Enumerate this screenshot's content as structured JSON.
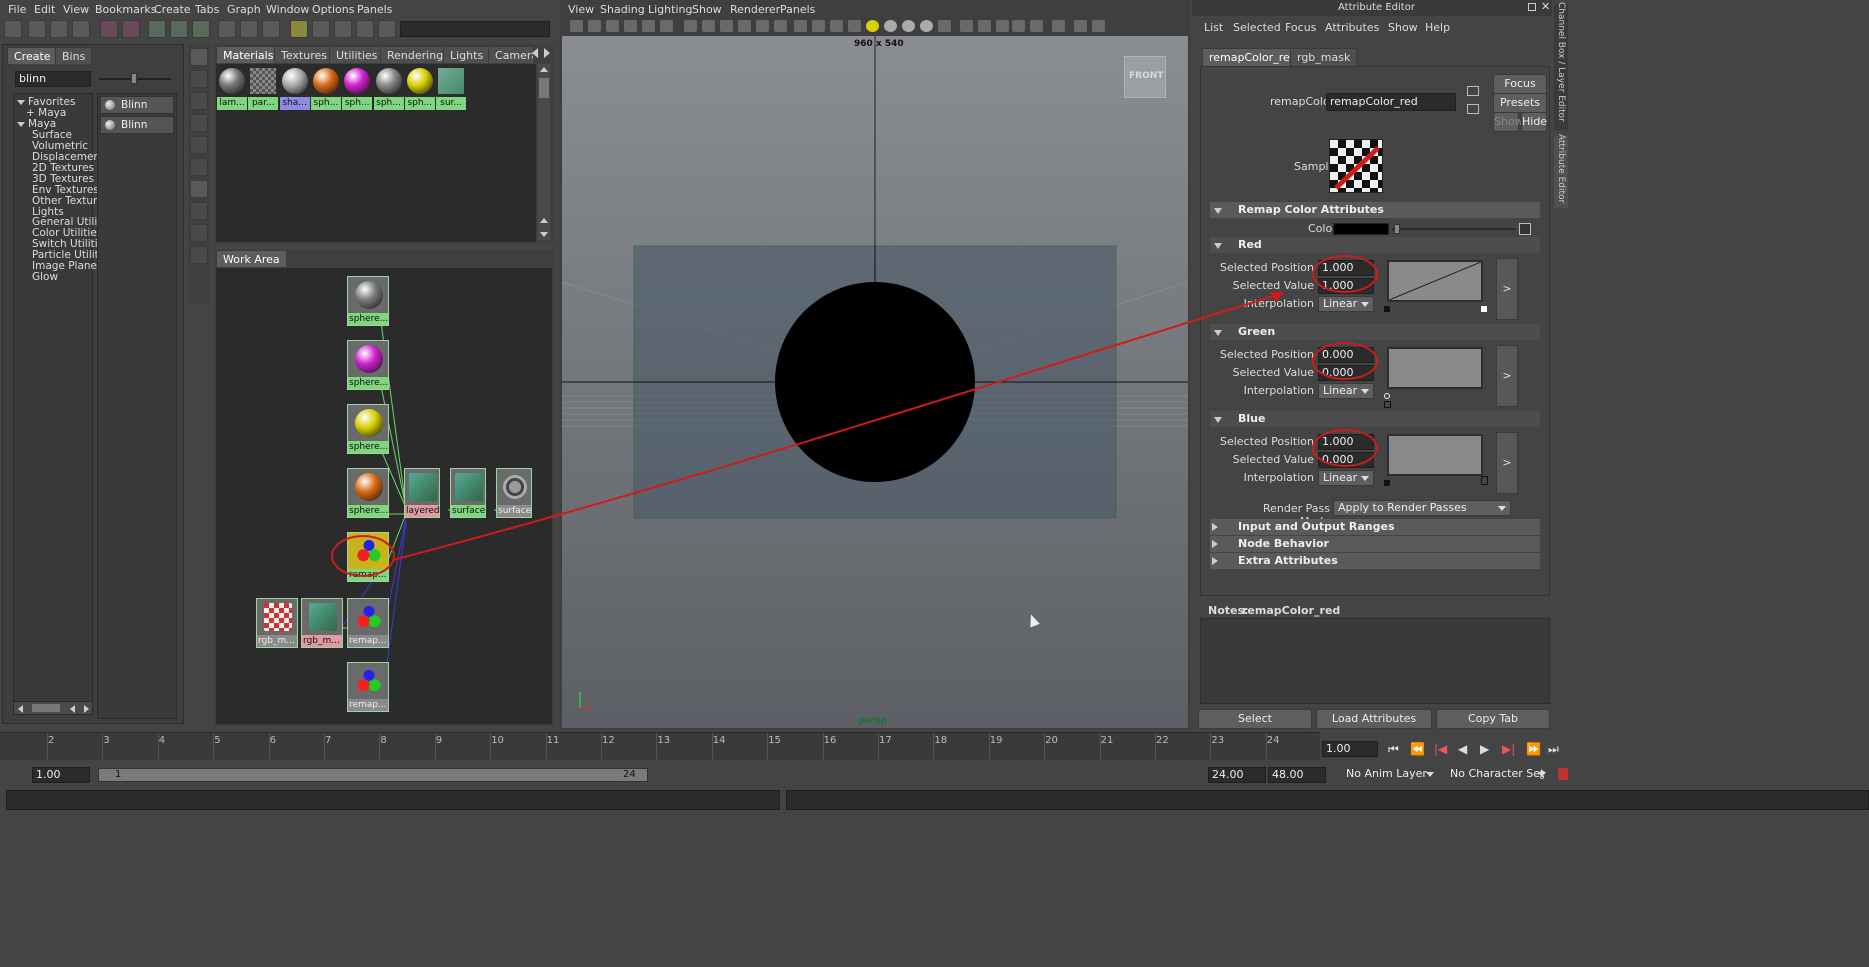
{
  "menubar": {
    "items": [
      "File",
      "Edit",
      "View",
      "Bookmarks",
      "Create",
      "Tabs",
      "Graph",
      "Window",
      "Options",
      "Panels"
    ]
  },
  "hypershade": {
    "left_tabs": [
      "Create",
      "Bins"
    ],
    "search_value": "blinn",
    "tree": [
      {
        "label": "Favorites",
        "expanded": true
      },
      {
        "label": "+ Maya",
        "indent": true
      },
      {
        "label": "Maya",
        "expanded": true
      },
      {
        "label": "Surface",
        "sub": true
      },
      {
        "label": "Volumetric",
        "sub": true
      },
      {
        "label": "Displacement",
        "sub": true
      },
      {
        "label": "2D Textures",
        "sub": true
      },
      {
        "label": "3D Textures",
        "sub": true
      },
      {
        "label": "Env Textures",
        "sub": true
      },
      {
        "label": "Other Textures",
        "sub": true
      },
      {
        "label": "Lights",
        "sub": true
      },
      {
        "label": "General Utilities",
        "sub": true
      },
      {
        "label": "Color Utilities",
        "sub": true
      },
      {
        "label": "Switch Utilities",
        "sub": true
      },
      {
        "label": "Particle Utilities",
        "sub": true
      },
      {
        "label": "Image Planes",
        "sub": true
      },
      {
        "label": "Glow",
        "sub": true
      }
    ],
    "results": [
      "Blinn",
      "Blinn"
    ],
    "top_tabs": [
      "Materials",
      "Textures",
      "Utilities",
      "Rendering",
      "Lights",
      "Camera"
    ],
    "swatches": [
      {
        "label": "lam...",
        "color": "#777"
      },
      {
        "label": "par...",
        "color": "#2aa"
      },
      {
        "label": "sha...",
        "color": "#aaa",
        "selected": true
      },
      {
        "label": "sph...",
        "color": "#d86a14"
      },
      {
        "label": "sph...",
        "color": "#d020d0"
      },
      {
        "label": "sph...",
        "color": "#888"
      },
      {
        "label": "sph...",
        "color": "#d8d000"
      },
      {
        "label": "sur...",
        "color": "#5a8"
      }
    ],
    "work_area_tab": "Work Area",
    "nodes": [
      {
        "label": "sphere...",
        "color": "#7a7a7a"
      },
      {
        "label": "sphere...",
        "color": "#d020d0"
      },
      {
        "label": "sphere...",
        "color": "#d8d000"
      },
      {
        "label": "sphere...",
        "color": "#d86a14"
      },
      {
        "label": "remap...",
        "color": "remap"
      },
      {
        "label": "layered...",
        "color": "tex"
      },
      {
        "label": "surface...",
        "color": "tex"
      },
      {
        "label": "surface...",
        "color": "gear"
      },
      {
        "label": "rgb_m...",
        "color": "checker"
      },
      {
        "label": "rgb_m...",
        "color": "tex"
      },
      {
        "label": "remap...",
        "color": "remap"
      },
      {
        "label": "remap...",
        "color": "remap"
      }
    ]
  },
  "viewport": {
    "menu": [
      "View",
      "Shading",
      "Lighting",
      "Show",
      "Renderer",
      "Panels"
    ],
    "resolution": "960 x 540",
    "camera": "persp",
    "view_cube": "FRONT"
  },
  "attribute_editor": {
    "title": "Attribute Editor",
    "menu": [
      "List",
      "Selected",
      "Focus",
      "Attributes",
      "Show",
      "Help"
    ],
    "tabs": [
      "remapColor_red",
      "rgb_mask"
    ],
    "node_type_label": "remapColor:",
    "node_name": "remapColor_red",
    "buttons": {
      "focus": "Focus",
      "presets": "Presets",
      "show": "Show",
      "hide": "Hide"
    },
    "sample_label": "Sample",
    "sections": {
      "remap": "Remap Color Attributes",
      "color_label": "Color",
      "red": "Red",
      "green": "Green",
      "blue": "Blue",
      "io": "Input and Output Ranges",
      "behavior": "Node Behavior",
      "extra": "Extra Attributes"
    },
    "labels": {
      "pos": "Selected Position",
      "val": "Selected Value",
      "interp": "Interpolation"
    },
    "red": {
      "pos": "1.000",
      "val": "1.000",
      "interp": "Linear"
    },
    "green": {
      "pos": "0.000",
      "val": "0.000",
      "interp": "Linear"
    },
    "blue": {
      "pos": "1.000",
      "val": "0.000",
      "interp": "Linear"
    },
    "render_pass_label": "Render Pass Mode",
    "render_pass_value": "Apply to Render Passes",
    "notes_label": "Notes:",
    "notes_name": "remapColor_red",
    "bottom_buttons": [
      "Select",
      "Load Attributes",
      "Copy Tab"
    ],
    "side_tabs": [
      "Channel Box / Layer Editor",
      "Attribute Editor"
    ]
  },
  "timeline": {
    "ticks": [
      "2",
      "3",
      "4",
      "5",
      "6",
      "7",
      "8",
      "9",
      "10",
      "11",
      "12",
      "13",
      "14",
      "15",
      "16",
      "17",
      "18",
      "19",
      "20",
      "21",
      "22",
      "23",
      "24"
    ],
    "current_frame": "1.00",
    "range_start": "1.00",
    "slider_start": "1",
    "slider_end": "24",
    "end_a": "24.00",
    "end_b": "48.00",
    "anim_layer": "No Anim Layer",
    "char_set": "No Character Set"
  }
}
